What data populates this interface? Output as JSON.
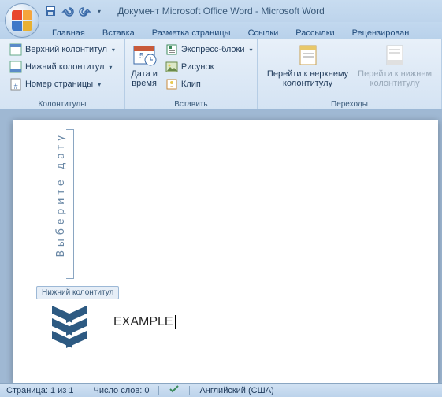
{
  "title": "Документ Microsoft Office Word - Microsoft Word",
  "tabs": {
    "t0": "Главная",
    "t1": "Вставка",
    "t2": "Разметка страницы",
    "t3": "Ссылки",
    "t4": "Рассылки",
    "t5": "Рецензирован"
  },
  "ribbon": {
    "g1": {
      "header": "Верхний колонтитул",
      "footer": "Нижний колонтитул",
      "pagenum": "Номер страницы",
      "title": "Колонтитулы"
    },
    "g2": {
      "date": "Дата и\nвремя",
      "title": "Вставить",
      "quick": "Экспресс-блоки",
      "pic": "Рисунок",
      "clip": "Клип"
    },
    "g3": {
      "gotop": "Перейти к верхнему\nколонтитулу",
      "gobot": "Перейти к нижнем\nколонтитулу",
      "title": "Переходы"
    }
  },
  "doc": {
    "date_placeholder": "Выберите дату",
    "footer_tab": "Нижний колонтитул",
    "footer_text": "EXAMPLE"
  },
  "status": {
    "page": "Страница: 1 из 1",
    "words": "Число слов: 0",
    "lang": "Английский (США)"
  }
}
